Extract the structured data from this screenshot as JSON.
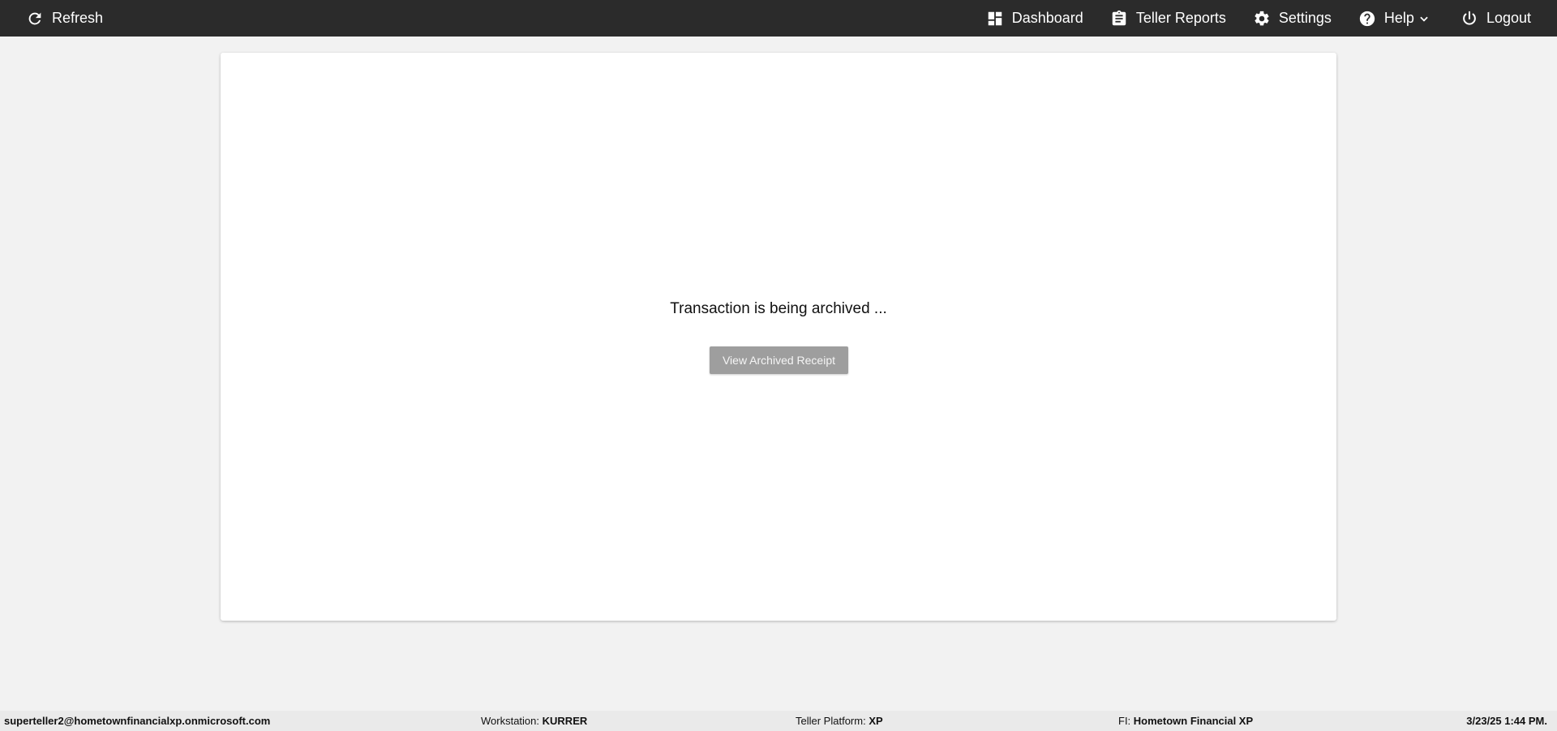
{
  "topbar": {
    "refresh_label": "Refresh",
    "nav": {
      "dashboard": "Dashboard",
      "teller_reports": "Teller Reports",
      "settings": "Settings",
      "help": "Help",
      "logout": "Logout"
    }
  },
  "main": {
    "status_message": "Transaction is being archived ...",
    "view_receipt_label": "View Archived Receipt"
  },
  "footer": {
    "user": "superteller2@hometownfinancialxp.onmicrosoft.com",
    "workstation_label": "Workstation:",
    "workstation_value": "KURRER",
    "platform_label": "Teller Platform:",
    "platform_value": "XP",
    "fi_label": "FI:",
    "fi_value": "Hometown Financial XP",
    "datetime": "3/23/25 1:44 PM."
  },
  "colors": {
    "topbar_bg": "#2b2b2b",
    "page_bg": "#f2f2f2",
    "button_disabled": "#9e9e9e"
  }
}
